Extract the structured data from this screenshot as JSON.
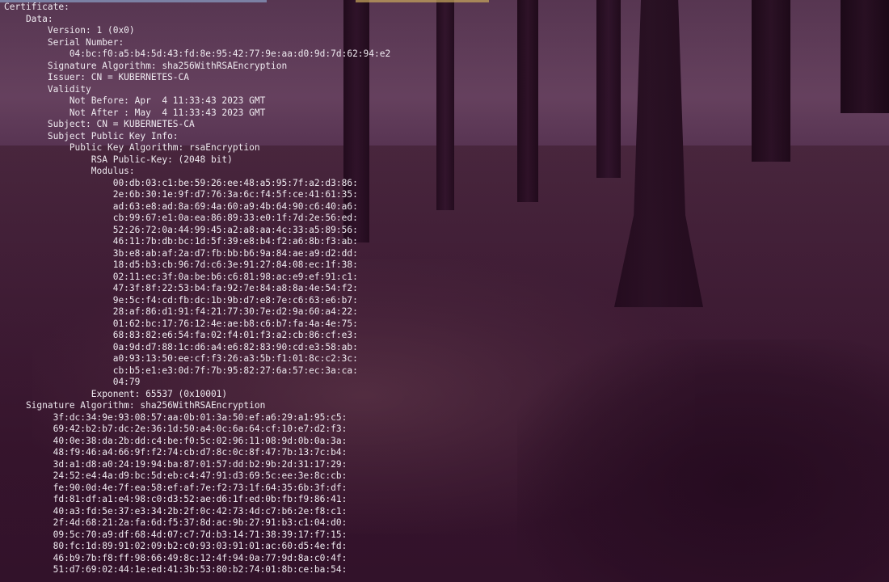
{
  "terminal": {
    "lines": [
      "Certificate:",
      "    Data:",
      "        Version: 1 (0x0)",
      "        Serial Number:",
      "            04:bc:f0:a5:b4:5d:43:fd:8e:95:42:77:9e:aa:d0:9d:7d:62:94:e2",
      "        Signature Algorithm: sha256WithRSAEncryption",
      "        Issuer: CN = KUBERNETES-CA",
      "        Validity",
      "            Not Before: Apr  4 11:33:43 2023 GMT",
      "            Not After : May  4 11:33:43 2023 GMT",
      "        Subject: CN = KUBERNETES-CA",
      "        Subject Public Key Info:",
      "            Public Key Algorithm: rsaEncryption",
      "                RSA Public-Key: (2048 bit)",
      "                Modulus:",
      "                    00:db:03:c1:be:59:26:ee:48:a5:95:7f:a2:d3:86:",
      "                    2e:6b:30:1e:9f:d7:76:3a:6c:f4:5f:ce:41:61:35:",
      "                    ad:63:e8:ad:8a:69:4a:60:a9:4b:64:90:c6:40:a6:",
      "                    cb:99:67:e1:0a:ea:86:89:33:e0:1f:7d:2e:56:ed:",
      "                    52:26:72:0a:44:99:45:a2:a8:aa:4c:33:a5:89:56:",
      "                    46:11:7b:db:bc:1d:5f:39:e8:b4:f2:a6:8b:f3:ab:",
      "                    3b:e8:ab:af:2a:d7:fb:bb:b6:9a:84:ae:a9:d2:dd:",
      "                    18:d5:b3:cb:96:7d:c6:3e:91:27:84:08:ec:1f:38:",
      "                    02:11:ec:3f:0a:be:b6:c6:81:98:ac:e9:ef:91:c1:",
      "                    47:3f:8f:22:53:b4:fa:92:7e:84:a8:8a:4e:54:f2:",
      "                    9e:5c:f4:cd:fb:dc:1b:9b:d7:e8:7e:c6:63:e6:b7:",
      "                    28:af:86:d1:91:f4:21:77:30:7e:d2:9a:60:a4:22:",
      "                    01:62:bc:17:76:12:4e:ae:b8:c6:b7:fa:4a:4e:75:",
      "                    68:83:82:e6:54:fa:02:f4:01:f3:a2:cb:86:cf:e3:",
      "                    0a:9d:d7:88:1c:d6:a4:e6:82:83:90:cd:e3:58:ab:",
      "                    a0:93:13:50:ee:cf:f3:26:a3:5b:f1:01:8c:c2:3c:",
      "                    cb:b5:e1:e3:0d:7f:7b:95:82:27:6a:57:ec:3a:ca:",
      "                    04:79",
      "                Exponent: 65537 (0x10001)",
      "    Signature Algorithm: sha256WithRSAEncryption",
      "         3f:dc:34:9e:93:08:57:aa:0b:01:3a:50:ef:a6:29:a1:95:c5:",
      "         69:42:b2:b7:dc:2e:36:1d:50:a4:0c:6a:64:cf:10:e7:d2:f3:",
      "         40:0e:38:da:2b:dd:c4:be:f0:5c:02:96:11:08:9d:0b:0a:3a:",
      "         48:f9:46:a4:66:9f:f2:74:cb:d7:8c:0c:8f:47:7b:13:7c:b4:",
      "         3d:a1:d8:a0:24:19:94:ba:87:01:57:dd:b2:9b:2d:31:17:29:",
      "         24:52:e4:4a:d9:bc:5d:eb:c4:47:91:d3:69:5c:ee:3e:8c:cb:",
      "         fe:90:0d:4e:7f:ea:58:ef:af:7e:f2:73:1f:64:35:6b:3f:df:",
      "         fd:81:df:a1:e4:98:c0:d3:52:ae:d6:1f:ed:0b:fb:f9:86:41:",
      "         40:a3:fd:5e:37:e3:34:2b:2f:0c:42:73:4d:c7:b6:2e:f8:c1:",
      "         2f:4d:68:21:2a:fa:6d:f5:37:8d:ac:9b:27:91:b3:c1:04:d0:",
      "         09:5c:70:a9:df:68:4d:07:c7:7d:b3:14:71:38:39:17:f7:15:",
      "         80:fc:1d:89:91:02:09:b2:c0:93:03:91:01:ac:60:d5:4e:fd:",
      "         46:b9:7b:f8:ff:98:66:49:8c:12:4f:94:0a:77:9d:8a:c0:4f:",
      "         51:d7:69:02:44:1e:ed:41:3b:53:80:b2:74:01:8b:ce:ba:54:"
    ]
  }
}
